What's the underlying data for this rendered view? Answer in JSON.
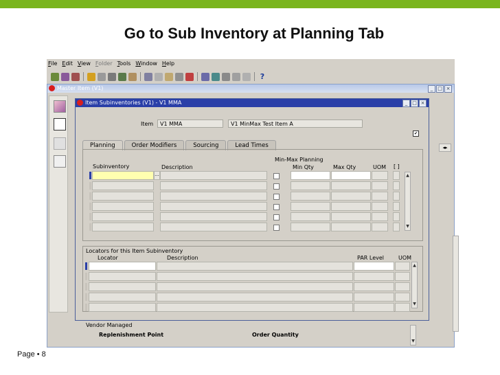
{
  "slide": {
    "title": "Go to Sub Inventory at Planning Tab",
    "page": "Page • 8"
  },
  "app": {
    "menu": [
      "File",
      "Edit",
      "View",
      "Folder",
      "Tools",
      "Window",
      "Help"
    ],
    "master_window_title": "Master Item (V1)",
    "sub_window_title": "Item Subinventories (V1) - V1 MMA"
  },
  "item": {
    "label": "Item",
    "code": "V1 MMA",
    "description": "V1 MinMax Test Item A"
  },
  "tabs": [
    "Planning",
    "Order Modifiers",
    "Sourcing",
    "Lead Times"
  ],
  "planning": {
    "group_label": "Min-Max Planning",
    "columns": {
      "subinventory": "Subinventory",
      "description": "Description",
      "min_qty": "Min Qty",
      "max_qty": "Max Qty",
      "uom": "UOM",
      "bracket": "[ ]"
    },
    "lov_button": "...",
    "rows": 6
  },
  "locators": {
    "section_label": "Locators for this Item Subinventory",
    "columns": {
      "locator": "Locator",
      "description": "Description",
      "par_level": "PAR Level",
      "uom": "UOM"
    },
    "rows": 5
  },
  "vendor": {
    "label": "Vendor Managed",
    "replenishment_point": "Replenishment Point",
    "order_quantity": "Order Quantity"
  },
  "colors": {
    "accent_green": "#7ab51d",
    "title_bar_blue": "#2a3fa8",
    "active_field": "#ffffb0"
  }
}
